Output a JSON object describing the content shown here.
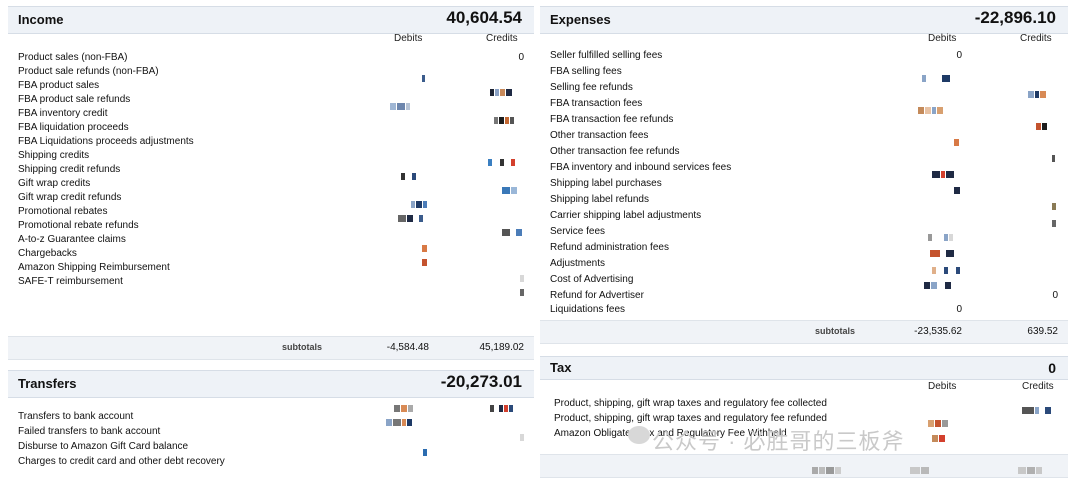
{
  "income": {
    "title": "Income",
    "total": "40,604.54",
    "col_debits": "Debits",
    "col_credits": "Credits",
    "rows": [
      "Product sales (non-FBA)",
      "Product sale refunds (non-FBA)",
      "FBA product sales",
      "FBA product sale refunds",
      "FBA inventory credit",
      "FBA liquidation proceeds",
      "FBA Liquidations proceeds adjustments",
      "Shipping credits",
      "Shipping credit refunds",
      "Gift wrap credits",
      "Gift wrap credit refunds",
      "Promotional rebates",
      "Promotional rebate refunds",
      "A-to-z Guarantee claims",
      "Chargebacks",
      "Amazon Shipping Reimbursement",
      "SAFE-T reimbursement"
    ],
    "first_credit": "0",
    "subtotal_label": "subtotals",
    "subtotal_debits": "-4,584.48",
    "subtotal_credits": "45,189.02"
  },
  "expenses": {
    "title": "Expenses",
    "total": "-22,896.10",
    "col_debits": "Debits",
    "col_credits": "Credits",
    "rows": [
      "Seller fulfilled selling fees",
      "FBA selling fees",
      "Selling fee refunds",
      "FBA transaction fees",
      "FBA transaction fee refunds",
      "Other transaction fees",
      "Other transaction fee refunds",
      "FBA inventory and inbound services fees",
      "Shipping label purchases",
      "Shipping label refunds",
      "Carrier shipping label adjustments",
      "Service fees",
      "Refund administration fees",
      "Adjustments",
      "Cost of Advertising",
      "Refund for Advertiser",
      "Liquidations fees"
    ],
    "first_debit": "0",
    "refund_adv_credit": "0",
    "liq_debit": "0",
    "subtotal_label": "subtotals",
    "subtotal_debits": "-23,535.62",
    "subtotal_credits": "639.52"
  },
  "transfers": {
    "title": "Transfers",
    "total": "-20,273.01",
    "rows": [
      "Transfers to bank account",
      "Failed transfers to bank account",
      "Disburse to Amazon Gift Card balance",
      "Charges to credit card and other debt recovery"
    ]
  },
  "tax": {
    "title": "Tax",
    "total": "0",
    "col_debits": "Debits",
    "col_credits": "Credits",
    "rows": [
      "Product, shipping, gift wrap taxes and regulatory fee collected",
      "Product, shipping, gift wrap taxes and regulatory fee refunded",
      "Amazon Obligated Tax and Regulatory Fee Withheld"
    ]
  },
  "watermark": "公众号 · 必胜哥的三板斧"
}
